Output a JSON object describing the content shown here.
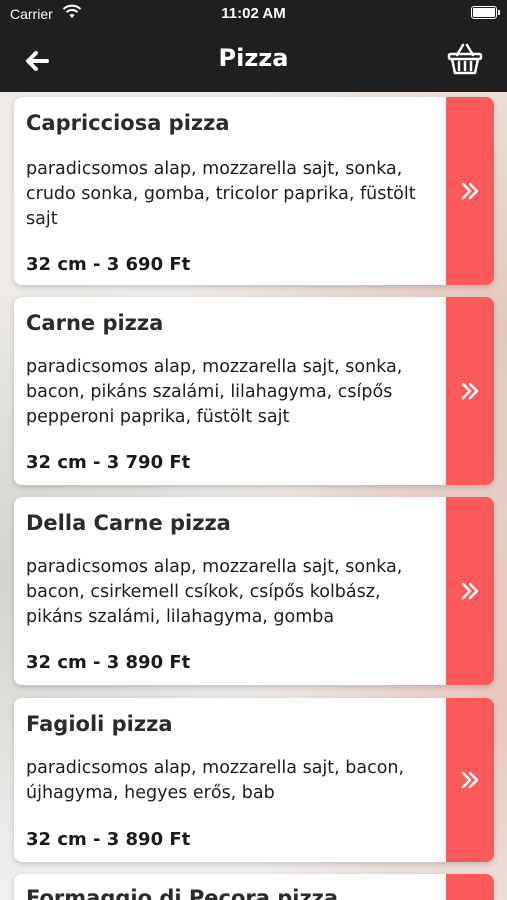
{
  "status_bar": {
    "carrier": "Carrier",
    "time": "11:02 AM"
  },
  "header": {
    "title": "Pizza",
    "back_icon": "arrow-left-icon",
    "cart_icon": "basket-icon"
  },
  "colors": {
    "header_bg": "#1f1f1f",
    "accent": "#fc5a5a"
  },
  "products": [
    {
      "name": "Capricciosa pizza",
      "description": "paradicsomos alap, mozzarella sajt, sonka, crudo sonka, gomba, tricolor paprika, füstölt sajt",
      "price": "32 cm - 3 690 Ft"
    },
    {
      "name": "Carne pizza",
      "description": "paradicsomos alap, mozzarella sajt, sonka, bacon, pikáns szalámi, lilahagyma, csípős pepperoni paprika, füstölt sajt",
      "price": "32 cm - 3 790 Ft"
    },
    {
      "name": "Della Carne pizza",
      "description": "paradicsomos alap, mozzarella sajt, sonka, bacon, csirkemell csíkok, csípős kolbász, pikáns szalámi, lilahagyma, gomba",
      "price": "32 cm - 3 890 Ft"
    },
    {
      "name": "Fagioli pizza",
      "description": "paradicsomos alap, mozzarella sajt, bacon, újhagyma, hegyes erős, bab",
      "price": "32 cm - 3 890 Ft"
    },
    {
      "name": "Formaggio di Pecora pizza",
      "description": "",
      "price": ""
    }
  ]
}
